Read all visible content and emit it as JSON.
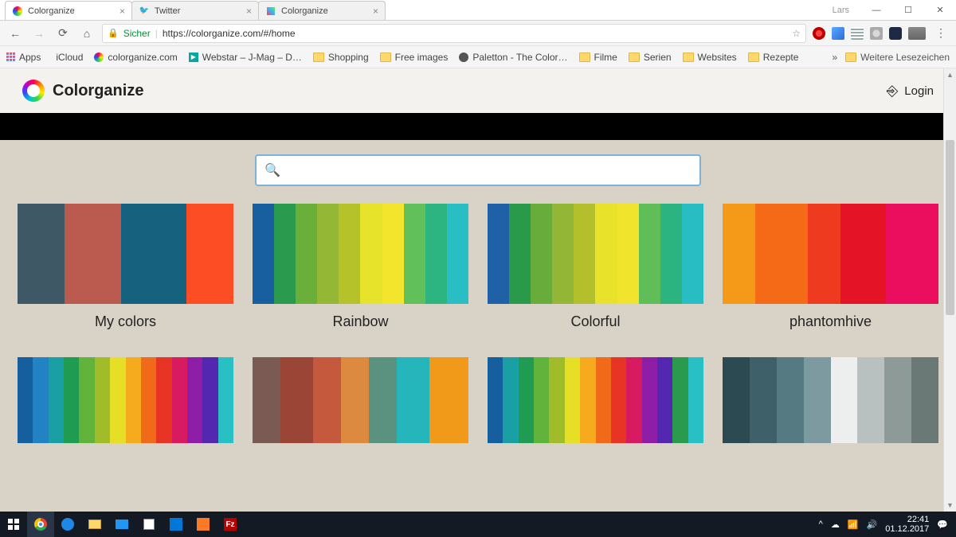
{
  "chrome": {
    "tabs": [
      {
        "label": "Colorganize",
        "type": "colorganize"
      },
      {
        "label": "Twitter",
        "type": "twitter"
      },
      {
        "label": "Colorganize",
        "type": "colorganize2"
      }
    ],
    "user": "Lars",
    "nav": {
      "secure": "Sicher",
      "url": "https://colorganize.com/#/home"
    },
    "bookmarks": [
      "Apps",
      "iCloud",
      "colorganize.com",
      "Webstar – J-Mag – D…",
      "Shopping",
      "Free images",
      "Paletton - The Color…",
      "Filme",
      "Serien",
      "Websites",
      "Rezepte"
    ],
    "overflow": "»",
    "otherBookmarks": "Weitere Lesezeichen"
  },
  "app": {
    "brand": "Colorganize",
    "login": "Login",
    "search_placeholder": "",
    "palettes_row1": [
      {
        "title": "My colors",
        "colors": [
          "#3f5866",
          "#bb5b50",
          "#16627e",
          "#fd4d25"
        ],
        "weights": [
          1,
          1.2,
          1.4,
          1
        ]
      },
      {
        "title": "Rainbow",
        "colors": [
          "#175f9e",
          "#2a9a4e",
          "#6aaf3a",
          "#94b836",
          "#b6c22a",
          "#e7e32a",
          "#f2e52c",
          "#61c05a",
          "#2cb481",
          "#29bec3"
        ],
        "weights": [
          1,
          1,
          1,
          1,
          1,
          1,
          1,
          1,
          1,
          1
        ]
      },
      {
        "title": "Colorful",
        "colors": [
          "#2060a6",
          "#289a4a",
          "#68ad3b",
          "#93b636",
          "#b4c02b",
          "#e8e22b",
          "#f1e42d",
          "#5fbe58",
          "#2bb380",
          "#27bdc2"
        ],
        "weights": [
          1,
          1,
          1,
          1,
          1,
          1,
          1,
          1,
          1,
          1
        ]
      },
      {
        "title": "phantomhive",
        "colors": [
          "#f59a18",
          "#f46a17",
          "#ee3a1f",
          "#e41325",
          "#ec0e5e"
        ],
        "weights": [
          1,
          1.6,
          1,
          1.4,
          1.6
        ]
      }
    ],
    "palettes_row2": [
      {
        "colors": [
          "#155f9f",
          "#2182c4",
          "#19a0a4",
          "#1f9b52",
          "#62b33c",
          "#a0bd29",
          "#e7de26",
          "#f6aa1d",
          "#f06a1a",
          "#e83424",
          "#d81b60",
          "#8e1ea8",
          "#5327b0",
          "#28c0c5"
        ],
        "weights": [
          1,
          1,
          1,
          1,
          1,
          1,
          1,
          1,
          1,
          1,
          1,
          1,
          1,
          1
        ]
      },
      {
        "colors": [
          "#7a5a53",
          "#9a4536",
          "#c4593e",
          "#db8a3f",
          "#5a917f",
          "#24b6ba",
          "#f19a1a"
        ],
        "weights": [
          1,
          1.2,
          1,
          1,
          1,
          1.2,
          1.4
        ]
      },
      {
        "colors": [
          "#155f9f",
          "#19a0a4",
          "#1f9b52",
          "#62b33c",
          "#a0bd29",
          "#e7de26",
          "#f6aa1d",
          "#f06a1a",
          "#e83424",
          "#d81b60",
          "#8e1ea8",
          "#5327b0",
          "#2a9a4e",
          "#28c0c5"
        ],
        "weights": [
          1,
          1,
          1,
          1,
          1,
          1,
          1,
          1,
          1,
          1,
          1,
          1,
          1,
          1
        ]
      },
      {
        "colors": [
          "#2c4a52",
          "#3d6069",
          "#557a82",
          "#7d9aa0",
          "#edefef",
          "#b9c1c0",
          "#8e9a98",
          "#6a7876"
        ],
        "weights": [
          1,
          1,
          1,
          1,
          1,
          1,
          1,
          1
        ]
      }
    ]
  },
  "taskbar": {
    "time": "22:41",
    "date": "01.12.2017"
  }
}
